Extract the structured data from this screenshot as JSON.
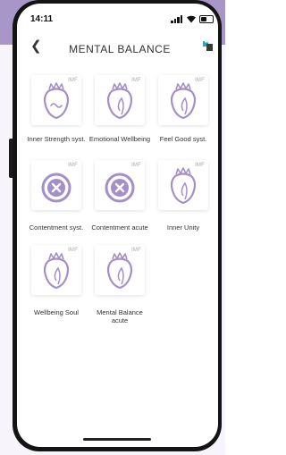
{
  "status": {
    "time": "14:11"
  },
  "header": {
    "title": "MENTAL BALANCE"
  },
  "tiles": [
    {
      "label": "Inner Strength syst.",
      "badge": "IMF",
      "icon": "strawberry-wave-icon"
    },
    {
      "label": "Emotional Wellbeing",
      "badge": "IMF",
      "icon": "strawberry-leaf-icon"
    },
    {
      "label": "Feel Good syst.",
      "badge": "IMF",
      "icon": "strawberry-leaf-icon"
    },
    {
      "label": "Contentment syst.",
      "badge": "IMF",
      "icon": "x-circle-icon"
    },
    {
      "label": "Contentment acute",
      "badge": "IMF",
      "icon": "x-circle-icon"
    },
    {
      "label": "Inner Unity",
      "badge": "IMF",
      "icon": "strawberry-leaf-icon"
    },
    {
      "label": "Wellbeing Soul",
      "badge": "IMF",
      "icon": "strawberry-leaf-icon"
    },
    {
      "label": "Mental Balance acute",
      "badge": "IMF",
      "icon": "strawberry-leaf-icon"
    }
  ],
  "colors": {
    "accent": "#a996c8",
    "icon": "#a58fc8"
  }
}
